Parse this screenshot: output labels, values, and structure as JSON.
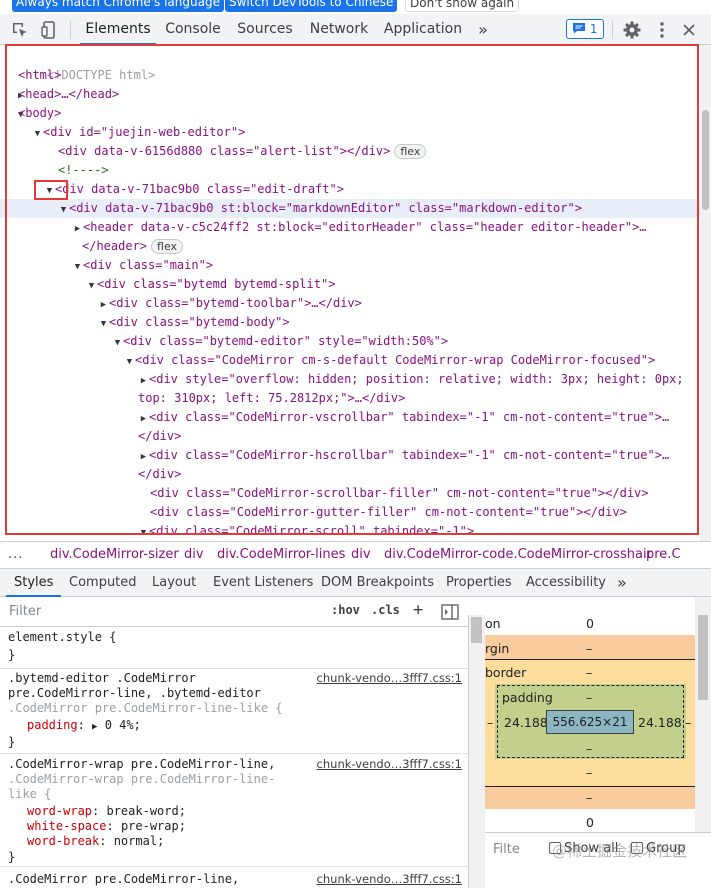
{
  "infobar": {
    "btn_always": "Always match Chrome's language",
    "btn_switch": "Switch DevTools to Chinese",
    "btn_dont": "Don't show again"
  },
  "toolbar": {
    "tabs": [
      "Elements",
      "Console",
      "Sources",
      "Network",
      "Application"
    ],
    "more": "»",
    "issues_count": "1",
    "icons": [
      "inspect-icon",
      "device-toggle-icon",
      "issues-icon",
      "gear-icon",
      "kebab-menu-icon",
      "close-icon"
    ]
  },
  "elements": {
    "lines": [
      {
        "tri": "",
        "html": "doctype",
        "text": "<!DOCTYPE html>"
      },
      {
        "text": "<html>"
      },
      {
        "text": "<head>…</head>"
      },
      {
        "text": "<body>"
      },
      {
        "text": "<div id=\"juejin-web-editor\">"
      },
      {
        "text": "<div data-v-6156d880 class=\"alert-list\"></div>"
      },
      {
        "text": "<!---->"
      },
      {
        "text": "<div data-v-71bac9b0 class=\"edit-draft\">"
      },
      {
        "text": "<div data-v-71bac9b0 st:block=\"markdownEditor\" class=\"markdown-editor\">"
      },
      {
        "text": "<header data-v-c5c24ff2 st:block=\"editorHeader\" class=\"header editor-header\">…"
      },
      {
        "text": "</header>"
      },
      {
        "text": "<div class=\"main\">"
      },
      {
        "text": "<div class=\"bytemd bytemd-split\">"
      },
      {
        "text": "<div class=\"bytemd-toolbar\">…</div>"
      },
      {
        "text": "<div class=\"bytemd-body\">"
      },
      {
        "text": "<div class=\"bytemd-editor\" style=\"width:50%\">"
      },
      {
        "text": "<div class=\"CodeMirror cm-s-default CodeMirror-wrap CodeMirror-focused\">"
      },
      {
        "text": "<div style=\"overflow: hidden; position: relative; width: 3px; height: 0px;"
      },
      {
        "text": "top: 310px; left: 75.2812px;\">…</div>"
      },
      {
        "text": "<div class=\"CodeMirror-vscrollbar\" tabindex=\"-1\" cm-not-content=\"true\">…"
      },
      {
        "text": "</div>"
      },
      {
        "text": "<div class=\"CodeMirror-hscrollbar\" tabindex=\"-1\" cm-not-content=\"true\">…"
      },
      {
        "text": "</div>"
      },
      {
        "text": "<div class=\"CodeMirror-scrollbar-filler\" cm-not-content=\"true\"></div>"
      },
      {
        "text": "<div class=\"CodeMirror-gutter-filler\" cm-not-content=\"true\"></div>"
      },
      {
        "text": "<div class=\"CodeMirror-scroll\" tabindex=\"-1\">"
      }
    ],
    "pill_flex": "flex"
  },
  "breadcrumbs": {
    "dots": "...",
    "items": [
      "div.CodeMirror-sizer",
      "div",
      "div.CodeMirror-lines",
      "div",
      "div.CodeMirror-code.CodeMirror-crosshair",
      "pre.C"
    ]
  },
  "subtabs": [
    "Styles",
    "Computed",
    "Layout",
    "Event Listeners",
    "DOM Breakpoints",
    "Properties",
    "Accessibility",
    "»"
  ],
  "filter": {
    "placeholder": "Filter",
    "hov": ":hov",
    "cls": ".cls",
    "plus": "+"
  },
  "styles": {
    "element_style": "element.style {",
    "close": "}",
    "rule1": {
      "sel1": ".bytemd-editor .CodeMirror",
      "sel2a": "pre.CodeMirror-line, ",
      "sel2b": ".bytemd-editor",
      "sel3": ".CodeMirror pre.CodeMirror-line-like {",
      "prop": "padding",
      "val": "0 4%;",
      "source": "chunk-vendo…3fff7.css:1"
    },
    "rule2": {
      "sel1": ".CodeMirror-wrap pre.CodeMirror-line,",
      "sel2": ".CodeMirror-wrap pre.CodeMirror-line-",
      "sel3": "like {",
      "p1": "word-wrap",
      "v1": "break-word;",
      "p2": "white-space",
      "v2": "pre-wrap;",
      "p3": "word-break",
      "v3": "normal;",
      "source": "chunk-vendo…3fff7.css:1"
    },
    "rule3": {
      "sel1": ".CodeMirror pre.CodeMirror-line,",
      "source": "chunk-vendo…3fff7.css:1"
    }
  },
  "boxmodel": {
    "position_label": "on",
    "position_val": "0",
    "margin_label": "rgin",
    "margin_val": "–",
    "border_label": "border",
    "border_val": "–",
    "padding_label": "padding",
    "padding_val": "–",
    "pad_left": "24.188",
    "pad_right": "24.188",
    "content": "556.625×21",
    "pad_bottom": "–",
    "border_bottom": "–",
    "margin_bottom": "–",
    "position_bottom": "0",
    "side_dash_left": "–",
    "side_dash_right": "–"
  },
  "footer": {
    "filter": "Filte",
    "show_all": "Show all",
    "group": "Group"
  },
  "watermark": "@稀土掘金技术社区",
  "colors": {
    "accent": "#1a73e8",
    "highlight": "#e53935",
    "margin": "#f9cc9d",
    "border": "#fddd9b",
    "padding": "#c3d08b",
    "content": "#8cb6c0"
  }
}
